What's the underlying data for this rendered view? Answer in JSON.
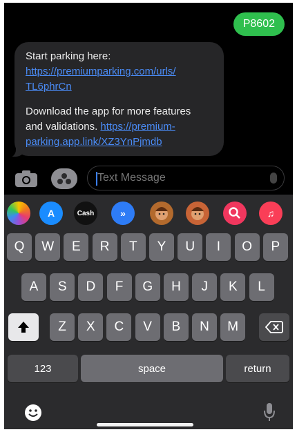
{
  "conversation": {
    "sent_message": "P8602",
    "received": {
      "line1": "Start parking here:",
      "link1_a": "https://premiumparking.com/urls/",
      "link1_b": "TL6phrCn",
      "line2a": "Download the app for more features",
      "line2b_prefix": "and validations.",
      "link2_a": "https://premium-",
      "link2_b": "parking.app.link/XZ3YnPjmdb"
    }
  },
  "compose": {
    "placeholder": "Text Message"
  },
  "app_strip": [
    {
      "name": "photos-app-icon",
      "label": "",
      "color": "#ffffff"
    },
    {
      "name": "app-store-icon",
      "label": "A",
      "color": "#1a8cff"
    },
    {
      "name": "apple-cash-icon",
      "label": "Cash",
      "color": "#111111"
    },
    {
      "name": "fast-forward-app-icon",
      "label": "»",
      "color": "#2e7cf6"
    },
    {
      "name": "memoji-icon-1",
      "label": "",
      "color": "#b36a2d"
    },
    {
      "name": "memoji-icon-2",
      "label": "",
      "color": "#c86436"
    },
    {
      "name": "search-images-icon",
      "label": "",
      "color": "#f0375e"
    },
    {
      "name": "music-icon",
      "label": "♫",
      "color": "#fa3e57"
    }
  ],
  "keyboard": {
    "row1": [
      "Q",
      "W",
      "E",
      "R",
      "T",
      "Y",
      "U",
      "I",
      "O",
      "P"
    ],
    "row2": [
      "A",
      "S",
      "D",
      "F",
      "G",
      "H",
      "J",
      "K",
      "L"
    ],
    "row3": [
      "Z",
      "X",
      "C",
      "V",
      "B",
      "N",
      "M"
    ],
    "numbers_label": "123",
    "space_label": "space",
    "return_label": "return"
  },
  "colors": {
    "sent_bubble": "#2fbf4e",
    "received_bubble": "#262628",
    "link": "#4a8bf5",
    "cursor": "#3a7ff6"
  }
}
